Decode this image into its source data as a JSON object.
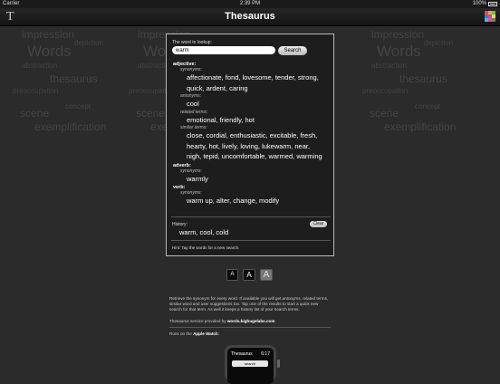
{
  "status_bar": {
    "carrier": "Carrier",
    "time": "2:39 PM",
    "battery": "100%"
  },
  "nav": {
    "title": "Thesaurus",
    "logo": "T"
  },
  "background_words": [
    "impression",
    "depiction",
    "Words",
    "abstraction",
    "thesaurus",
    "preoccupation",
    "concept",
    "scene",
    "exemplification"
  ],
  "panel": {
    "label": "The word to lookup:",
    "input_value": "warm",
    "search_label": "Search",
    "sections": [
      {
        "pos": "adjective:",
        "groups": [
          {
            "label": "synonyms:",
            "lines": [
              "affectionate, fond, lovesome, tender, strong,",
              "quick, ardent, caring"
            ]
          },
          {
            "label": "antonyms:",
            "lines": [
              "cool"
            ]
          },
          {
            "label": "related terms:",
            "lines": [
              "emotional, friendly, hot"
            ]
          },
          {
            "label": "similar terms:",
            "lines": [
              "close, cordial, enthusiastic, excitable, fresh,",
              "hearty, hot, lively, loving, lukewarm, near,",
              "nigh, tepid, uncomfortable, warmed, warming"
            ]
          }
        ]
      },
      {
        "pos": "adverb:",
        "groups": [
          {
            "label": "synonyms:",
            "lines": [
              "warmly"
            ]
          }
        ]
      },
      {
        "pos": "verb:",
        "groups": [
          {
            "label": "synonyms:",
            "lines": [
              "warm up, alter, change, modify"
            ]
          }
        ]
      }
    ],
    "history_label": "History:",
    "clear_label": "Clear",
    "history_words": "warm, cool, cold",
    "hint": "Hint: Tap the words for a new search."
  },
  "font_buttons": [
    "A",
    "A",
    "A"
  ],
  "description": "Retrieve the synonym for every word. If available you will get antonyms, related terms, similar word and user suggestions too. Tap one of the results to start a quick new search for that term. As well it keeps a history list of your search terms.",
  "provided": {
    "prefix": "Thesaurus service provided by ",
    "link": "words.bighugelabs.com"
  },
  "watch_line": {
    "prefix": "Runs on the ",
    "bold": "Apple Watch",
    "suffix": ":"
  },
  "watch": {
    "title": "Thesaurus",
    "time": "6:17",
    "search": "search"
  },
  "colors": {
    "logo_blocks": [
      "#e94b3c",
      "#f2a33a",
      "#6bbf4e",
      "#3a7bd5",
      "#b54ed6",
      "#f2d43a",
      "#3ac1d5",
      "#e94b8f",
      "#7a7a7a"
    ]
  }
}
